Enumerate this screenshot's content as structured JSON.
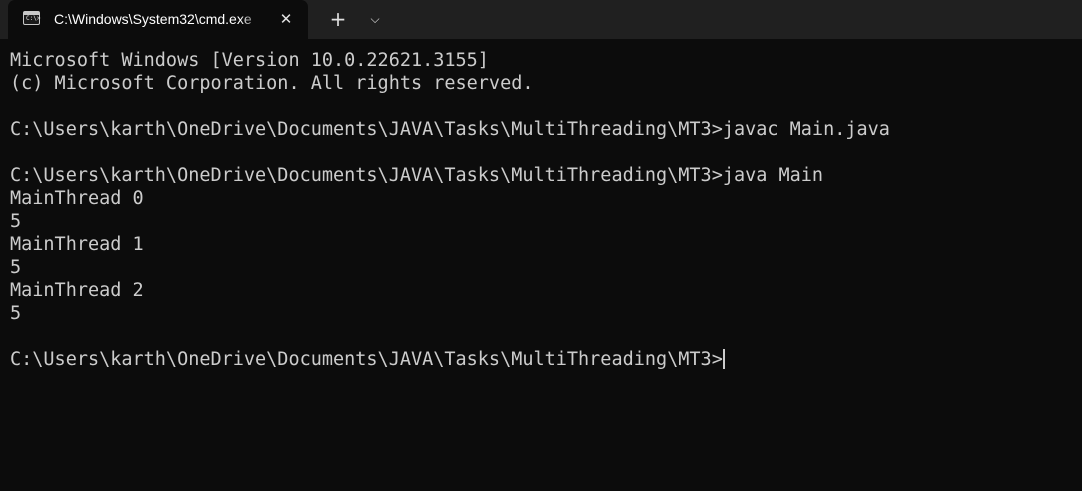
{
  "tab": {
    "title": "C:\\Windows\\System32\\cmd.exe",
    "icon": "cmd-icon",
    "icon_prompt": "C:\\>",
    "close_label": "✕"
  },
  "titlebar": {
    "new_tab_label": "+",
    "dropdown_label": "⌵"
  },
  "terminal": {
    "lines": [
      "Microsoft Windows [Version 10.0.22621.3155]",
      "(c) Microsoft Corporation. All rights reserved.",
      "",
      "C:\\Users\\karth\\OneDrive\\Documents\\JAVA\\Tasks\\MultiThreading\\MT3>javac Main.java",
      "",
      "C:\\Users\\karth\\OneDrive\\Documents\\JAVA\\Tasks\\MultiThreading\\MT3>java Main",
      "MainThread 0",
      "5",
      "MainThread 1",
      "5",
      "MainThread 2",
      "5",
      "",
      "C:\\Users\\karth\\OneDrive\\Documents\\JAVA\\Tasks\\MultiThreading\\MT3>"
    ]
  },
  "colors": {
    "background": "#0c0c0c",
    "titlebar": "#202020",
    "text": "#cccccc"
  }
}
